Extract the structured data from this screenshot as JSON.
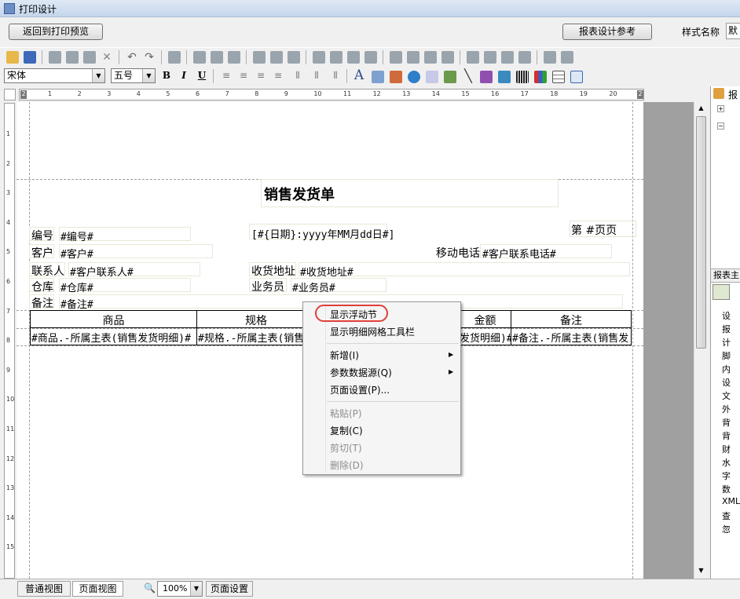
{
  "window": {
    "title": "打印设计"
  },
  "toolbar": {
    "back_label": "返回到打印预览",
    "ref_label": "报表设计参考",
    "style_label": "样式名称",
    "style_value": "默"
  },
  "format": {
    "font_name": "宋体",
    "font_size": "五号",
    "bold": "B",
    "italic": "I",
    "underline": "U",
    "text_icon": "A"
  },
  "ruler": {
    "h_marks": [
      "1",
      "2",
      "3",
      "4",
      "5",
      "6",
      "7",
      "8",
      "9",
      "10",
      "11",
      "12",
      "13",
      "14",
      "15",
      "16",
      "17",
      "18",
      "19",
      "20"
    ],
    "h_start": "2",
    "h_end": "2",
    "v_marks": [
      "1",
      "2",
      "3",
      "4",
      "5",
      "6",
      "7",
      "8",
      "9",
      "10",
      "11",
      "12",
      "13",
      "14",
      "15"
    ]
  },
  "report": {
    "title": "销售发货单",
    "page_label": "第 #页页",
    "date_field": "[#{日期}:yyyy年MM月dd日#]",
    "fields": [
      {
        "label": "编号",
        "value": "#编号#"
      },
      {
        "label": "客户",
        "value": "#客户#"
      },
      {
        "label": "联系人",
        "value": "#客户联系人#"
      },
      {
        "label": "仓库",
        "value": "#仓库#"
      },
      {
        "label": "备注",
        "value": "#备注#"
      },
      {
        "label": "收货地址",
        "value": "#收货地址#"
      },
      {
        "label": "业务员",
        "value": "#业务员#"
      },
      {
        "label": "移动电话",
        "value": "#客户联系电话#"
      }
    ],
    "table": {
      "headers": [
        "商品",
        "规格",
        "金额",
        "备注"
      ],
      "row": [
        "#商品.-所属主表(销售发货明细)#",
        "#规格.-所属主表(销售",
        "发货明细)#",
        "#备注.-所属主表(销售发"
      ]
    }
  },
  "context_menu": {
    "items": [
      {
        "label": "显示浮动节",
        "enabled": true,
        "highlighted": true
      },
      {
        "label": "显示明细网格工具栏",
        "enabled": true
      },
      {
        "label": "新增(I)",
        "enabled": true,
        "submenu": true
      },
      {
        "label": "参数数据源(Q)",
        "enabled": true,
        "submenu": true
      },
      {
        "label": "页面设置(P)...",
        "enabled": true
      },
      {
        "label": "粘贴(P)",
        "enabled": false
      },
      {
        "label": "复制(C)",
        "enabled": true
      },
      {
        "label": "剪切(T)",
        "enabled": false
      },
      {
        "label": "删除(D)",
        "enabled": false
      }
    ]
  },
  "right_panel": {
    "title": "报",
    "section": "报表主",
    "items": [
      "设",
      "报",
      "计",
      "脚",
      "内",
      "设",
      "文",
      "外",
      "背",
      "背",
      "财",
      "水",
      "字",
      "数",
      "XML",
      "查",
      "忽"
    ]
  },
  "status": {
    "normal_view": "普通视图",
    "page_view": "页面视图",
    "zoom": "100%",
    "page_setup": "页面设置"
  },
  "colors": {
    "accent": "#e0403a",
    "titlebar": "#c4d6ec"
  }
}
